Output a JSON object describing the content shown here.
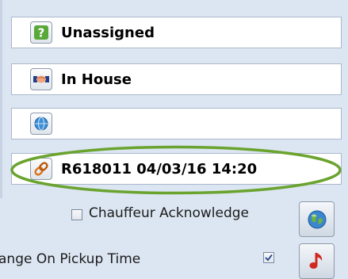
{
  "rows": [
    {
      "label": "Unassigned",
      "icon": "question-mark-icon"
    },
    {
      "label": "In House",
      "icon": "handshake-icon"
    },
    {
      "label": "",
      "icon": "globe-small-icon"
    },
    {
      "label": "R618011 04/03/16 14:20",
      "icon": "link-chain-icon"
    }
  ],
  "checkboxes": {
    "chauffeur_acknowledge": {
      "label": "Chauffeur Acknowledge",
      "checked": false
    },
    "change_on_pickup_time": {
      "label": "ange On Pickup Time",
      "checked": true
    }
  },
  "buttons": {
    "globe": {
      "icon": "globe-icon"
    },
    "alert": {
      "icon": "music-note-icon"
    }
  },
  "colors": {
    "highlight_ellipse": "#6aa32e",
    "panel_background": "#dce6f2",
    "row_border": "#a9b8cc"
  }
}
